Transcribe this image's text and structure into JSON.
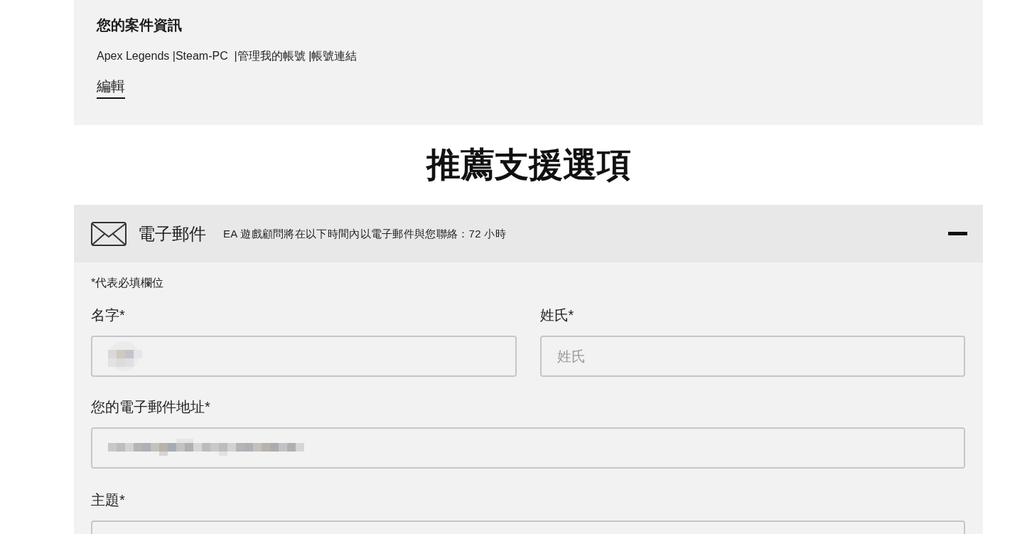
{
  "case_info": {
    "title": "您的案件資訊",
    "summary": "Apex Legends |Steam-PC  |管理我的帳號 |帳號連結",
    "edit_link": "編輯"
  },
  "heading": "推薦支援選項",
  "email_option": {
    "title": "電子郵件",
    "description": "EA 遊戲顧問將在以下時間內以電子郵件與您聯絡：72 小時",
    "expanded": true
  },
  "form": {
    "required_note": "*代表必填欄位",
    "first_name": {
      "label": "名字*",
      "redacted": true
    },
    "last_name": {
      "label": "姓氏*",
      "placeholder": "姓氏",
      "redacted": false
    },
    "email": {
      "label": "您的電子郵件地址*",
      "redacted": true
    },
    "subject": {
      "label": "主題*",
      "redacted": false
    }
  }
}
